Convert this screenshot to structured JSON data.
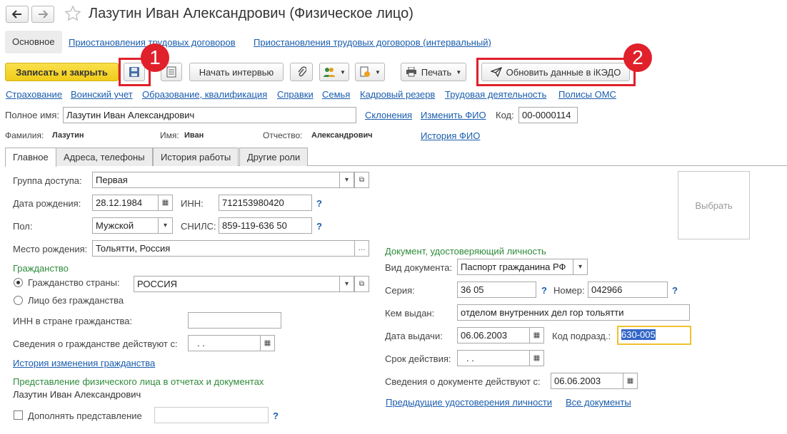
{
  "window": {
    "title": "Лазутин Иван Александрович (Физическое лицо)"
  },
  "top_tabs": [
    "Основное",
    "Приостановления трудовых договоров",
    "Приостановления трудовых договоров (интервальный)"
  ],
  "toolbar": {
    "save_close": "Записать и закрыть",
    "start_interview": "Начать интервью",
    "print": "Печать",
    "update_ikedo": "Обновить данные в iКЭДО"
  },
  "badges": [
    "1",
    "2"
  ],
  "section_links": [
    "Страхование",
    "Воинский учет",
    "Образование, квалификация",
    "Справки",
    "Семья",
    "Кадровый резерв",
    "Трудовая деятельность",
    "Полисы ОМС"
  ],
  "header": {
    "full_name_label": "Полное имя:",
    "full_name": "Лазутин Иван Александрович",
    "declensions_link": "Склонения",
    "change_fio_link": "Изменить ФИО",
    "code_label": "Код:",
    "code": "00-0000114",
    "surname_label": "Фамилия:",
    "surname": "Лазутин",
    "name_label": "Имя:",
    "name": "Иван",
    "patronymic_label": "Отчество:",
    "patronymic": "Александрович",
    "fio_history_link": "История ФИО"
  },
  "form_tabs": [
    "Главное",
    "Адреса, телефоны",
    "История работы",
    "Другие роли"
  ],
  "main": {
    "access_group_label": "Группа доступа:",
    "access_group": "Первая",
    "birth_date_label": "Дата рождения:",
    "birth_date": "28.12.1984",
    "inn_label": "ИНН:",
    "inn": "712153980420",
    "gender_label": "Пол:",
    "gender": "Мужской",
    "snils_label": "СНИЛС:",
    "snils": "859-119-636 50",
    "birth_place_label": "Место рождения:",
    "birth_place": "Тольятти, Россия",
    "citizenship_header": "Гражданство",
    "citizen_country_label": "Гражданство страны:",
    "citizen_country": "РОССИЯ",
    "stateless_label": "Лицо без гражданства",
    "foreign_inn_label": "ИНН в стране гражданства:",
    "citizenship_valid_label": "Сведения о гражданстве действуют с:",
    "citizenship_valid_date": ". .",
    "citizenship_history_link": "История изменения гражданства",
    "representation_header": "Представление физического лица в отчетах и документах",
    "representation": "Лазутин Иван Александрович",
    "supplement_label": "Дополнять представление",
    "q": "?",
    "photo_select": "Выбрать"
  },
  "document": {
    "header": "Документ, удостоверяющий личность",
    "type_label": "Вид документа:",
    "type": "Паспорт гражданина РФ",
    "series_label": "Серия:",
    "series": "36 05",
    "number_label": "Номер:",
    "number": "042966",
    "issued_by_label": "Кем выдан:",
    "issued_by": "отделом внутренних дел гор тольятти",
    "issue_date_label": "Дата выдачи:",
    "issue_date": "06.06.2003",
    "dept_code_label": "Код подразд.:",
    "dept_code": "630-005",
    "validity_label": "Срок действия:",
    "validity": ". .",
    "doc_valid_label": "Сведения о документе действуют с:",
    "doc_valid_date": "06.06.2003",
    "prev_docs_link": "Предыдущие удостоверения личности",
    "all_docs_link": "Все документы"
  },
  "colors": {
    "accent_yellow": "#f5d327",
    "highlight_red": "#e0202a",
    "link_blue": "#1a5dad",
    "section_green": "#2e8b3a"
  }
}
